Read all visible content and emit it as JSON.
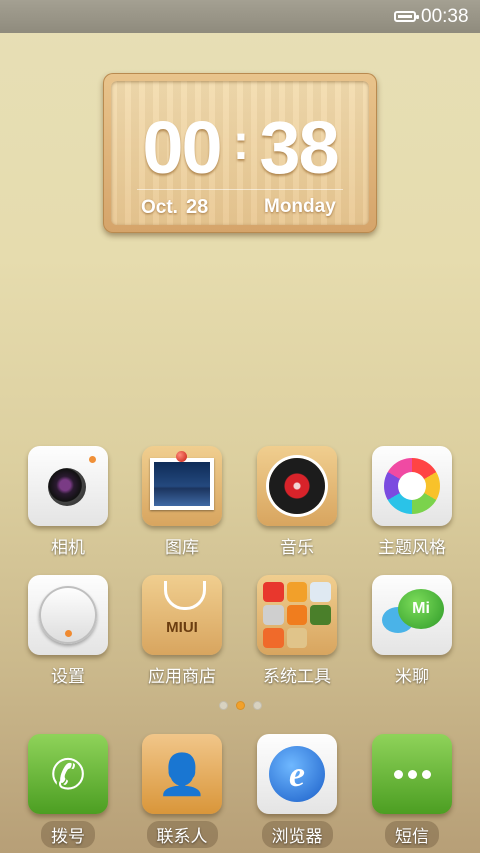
{
  "statusbar": {
    "time": "00:38",
    "battery_icon": "battery-icon"
  },
  "clock": {
    "hour": "00",
    "separator": ":",
    "minute": "38",
    "month": "Oct.",
    "day": "28",
    "weekday": "Monday"
  },
  "apps": [
    {
      "label": "相机",
      "icon": "camera-icon"
    },
    {
      "label": "图库",
      "icon": "gallery-icon"
    },
    {
      "label": "音乐",
      "icon": "music-icon"
    },
    {
      "label": "主题风格",
      "icon": "theme-icon"
    },
    {
      "label": "设置",
      "icon": "settings-icon"
    },
    {
      "label": "应用商店",
      "icon": "app-store-icon",
      "icon_text": "MIUI"
    },
    {
      "label": "系统工具",
      "icon": "system-tools-folder-icon"
    },
    {
      "label": "米聊",
      "icon": "mi-chat-icon",
      "icon_text": "Mi"
    }
  ],
  "page_indicator": {
    "pages": 3,
    "active": 2
  },
  "dock": [
    {
      "label": "拨号",
      "icon": "phone-icon"
    },
    {
      "label": "联系人",
      "icon": "contacts-icon"
    },
    {
      "label": "浏览器",
      "icon": "browser-icon",
      "icon_text": "e"
    },
    {
      "label": "短信",
      "icon": "sms-icon"
    }
  ],
  "colors": {
    "accent": "#f2a12a",
    "status_bar": "#9a9688"
  }
}
